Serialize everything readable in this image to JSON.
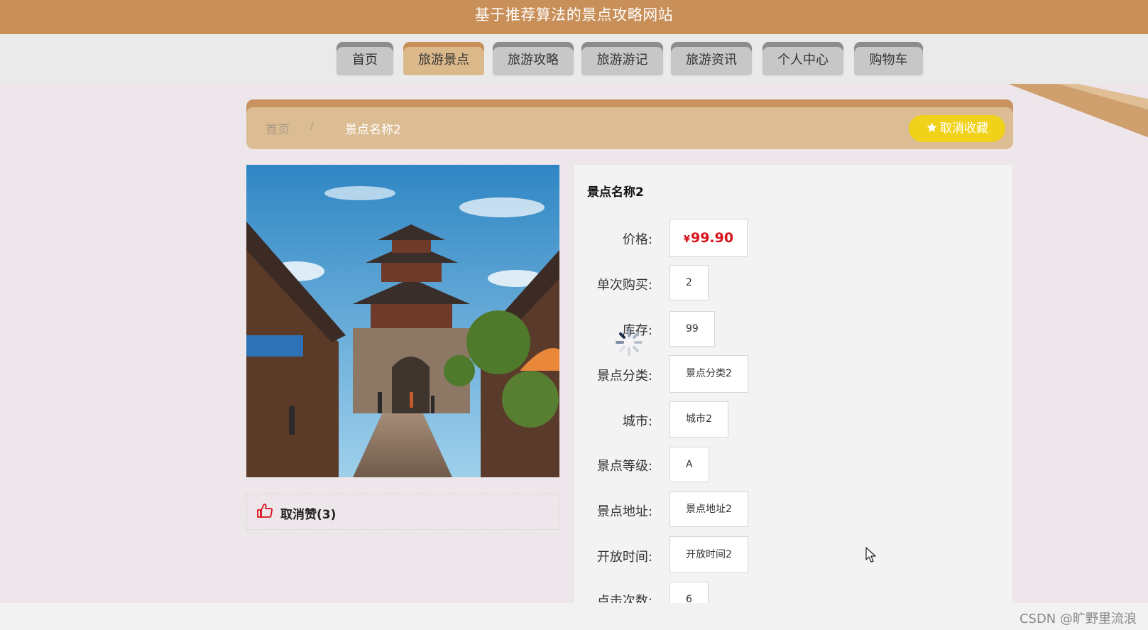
{
  "header": {
    "title": "基于推荐算法的景点攻略网站"
  },
  "nav": {
    "items": [
      {
        "label": "首页"
      },
      {
        "label": "旅游景点"
      },
      {
        "label": "旅游攻略"
      },
      {
        "label": "旅游游记"
      },
      {
        "label": "旅游资讯"
      },
      {
        "label": "个人中心"
      },
      {
        "label": "购物车"
      }
    ],
    "active": "旅游景点"
  },
  "breadcrumb": {
    "home": "首页",
    "separator": "/",
    "current": "景点名称2"
  },
  "favorite_button": {
    "label": "取消收藏",
    "icon": "star-icon"
  },
  "like": {
    "label": "取消赞(3)",
    "icon": "thumbs-up-icon"
  },
  "detail": {
    "title": "景点名称2",
    "price": {
      "label": "价格:",
      "currency": "¥",
      "value": "99.90"
    },
    "fields": [
      {
        "label": "单次购买:",
        "value": "2"
      },
      {
        "label": "库存:",
        "value": "99"
      },
      {
        "label": "景点分类:",
        "value": "景点分类2"
      },
      {
        "label": "城市:",
        "value": "城市2"
      },
      {
        "label": "景点等级:",
        "value": "A"
      },
      {
        "label": "景点地址:",
        "value": "景点地址2"
      },
      {
        "label": "开放时间:",
        "value": "开放时间2"
      },
      {
        "label": "点击次数:",
        "value": "6"
      }
    ]
  },
  "watermark": "CSDN @旷野里流浪",
  "colors": {
    "header": "#c98f58",
    "active_tab": "#dcb98a",
    "price": "#d8121a",
    "favorite": "#f0d21a"
  }
}
